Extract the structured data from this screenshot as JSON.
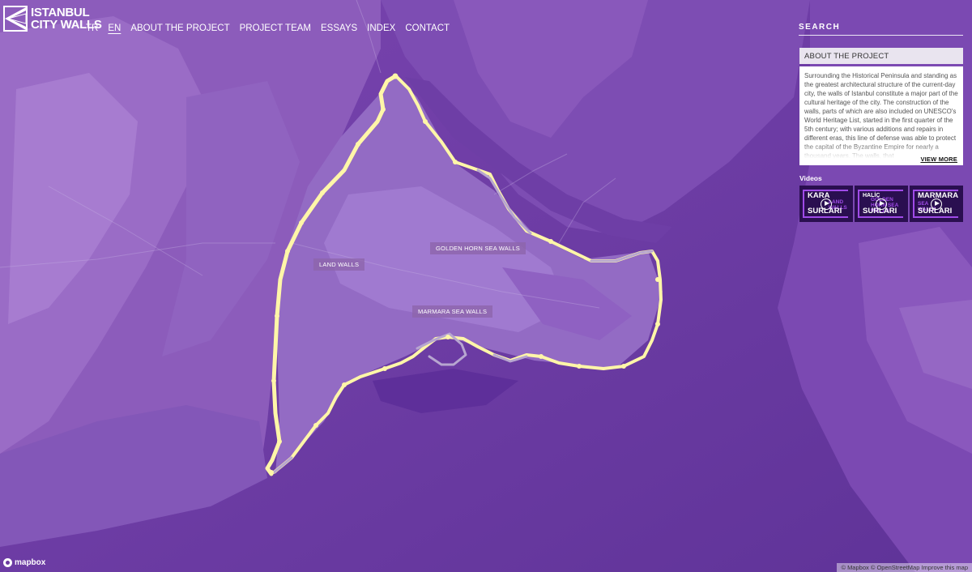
{
  "colors": {
    "sea": "#6a3a9e",
    "land_light": "#9d72c6",
    "land_mid": "#8a5db8",
    "land_dark": "#7d4cb3",
    "wall_bright": "#fff6a8",
    "wall_grey": "#b7a6d0"
  },
  "header": {
    "logo_line1": "ISTANBUL",
    "logo_line2": "CITY WALLS",
    "logo_icon": "logo-wedge-icon",
    "nav": [
      {
        "label": "TR",
        "active": false
      },
      {
        "label": "EN",
        "active": true
      },
      {
        "label": "ABOUT THE PROJECT",
        "active": false
      },
      {
        "label": "PROJECT TEAM",
        "active": false
      },
      {
        "label": "ESSAYS",
        "active": false
      },
      {
        "label": "INDEX",
        "active": false
      },
      {
        "label": "CONTACT",
        "active": false
      }
    ]
  },
  "panel": {
    "search_label": "SEARCH",
    "about_title": "ABOUT THE PROJECT",
    "about_text": "Surrounding the Historical Peninsula and standing as the greatest architectural structure of the current-day city, the walls of Istanbul constitute a major part of the cultural heritage of the city. The construction of the walls, parts of which are also included on UNESCO's World Heritage List, started in the first quarter of the 5th century; with various additions and repairs in different eras, this line of defense was able to protect the capital of the Byzantine Empire for nearly a thousand years. The walls, that",
    "view_more": "VIEW MORE",
    "videos_label": "Videos",
    "videos": [
      {
        "top": "KARA",
        "sub": "LAND WALLS",
        "bottom": "SURLARI"
      },
      {
        "top": "HALİÇ",
        "sub": "GOLDEN HORN SEA WALLS",
        "bottom": "SURLARI"
      },
      {
        "top": "MARMARA",
        "sub": "SEA WALLS",
        "bottom": "SURLARI"
      }
    ]
  },
  "map": {
    "labels": {
      "land_walls": "LAND WALLS",
      "golden_horn": "GOLDEN HORN SEA WALLS",
      "marmara": "MARMARA SEA WALLS"
    },
    "mapbox": "mapbox",
    "attribution": "© Mapbox © OpenStreetMap  Improve this map"
  }
}
